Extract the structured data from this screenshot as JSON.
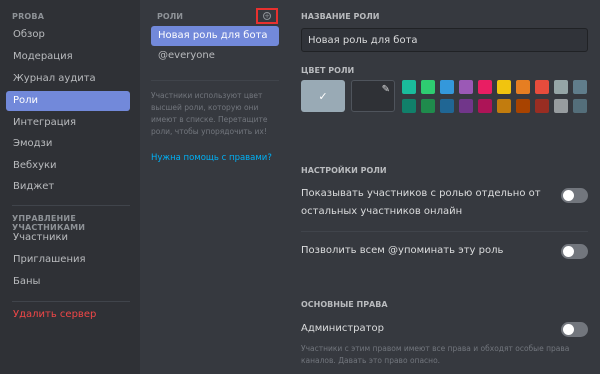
{
  "sidebar": {
    "server_section": "PROBA",
    "items": [
      {
        "label": "Обзор",
        "active": false
      },
      {
        "label": "Модерация",
        "active": false
      },
      {
        "label": "Журнал аудита",
        "active": false
      },
      {
        "label": "Роли",
        "active": true
      },
      {
        "label": "Интеграция",
        "active": false
      },
      {
        "label": "Эмодзи",
        "active": false
      },
      {
        "label": "Вебхуки",
        "active": false
      },
      {
        "label": "Виджет",
        "active": false
      }
    ],
    "members_section": "УПРАВЛЕНИЕ УЧАСТНИКАМИ",
    "member_items": [
      {
        "label": "Участники"
      },
      {
        "label": "Приглашения"
      },
      {
        "label": "Баны"
      }
    ],
    "delete_server": "Удалить сервер"
  },
  "roles": {
    "header": "РОЛИ",
    "items": [
      {
        "label": "Новая роль для бота",
        "selected": true
      },
      {
        "label": "@everyone",
        "selected": false
      }
    ],
    "hint": "Участники используют цвет высшей роли, которую они имеют в списке. Перетащите роли, чтобы упорядочить их!",
    "help_link": "Нужна помощь с правами?"
  },
  "role_settings": {
    "name_label": "НАЗВАНИЕ РОЛИ",
    "name_value": "Новая роль для бота",
    "color_label": "ЦВЕТ РОЛИ",
    "default_color": "#99aab5",
    "swatches_top": [
      "#1abc9c",
      "#2ecc71",
      "#3498db",
      "#9b59b6",
      "#e91e63",
      "#f1c40f",
      "#e67e22",
      "#e74c3c",
      "#95a5a6",
      "#607d8b"
    ],
    "swatches_bottom": [
      "#11806a",
      "#1f8b4c",
      "#206694",
      "#71368a",
      "#ad1457",
      "#c27c0e",
      "#a84300",
      "#992d22",
      "#979c9f",
      "#546e7a"
    ],
    "settings_label": "НАСТРОЙКИ РОЛИ",
    "toggle_hoist": {
      "label": "Показывать участников с ролью отдельно от остальных участников онлайн",
      "on": false
    },
    "toggle_mention": {
      "label": "Позволить всем @упоминать эту роль",
      "on": false
    },
    "permissions_label": "ОСНОВНЫЕ ПРАВА",
    "admin": {
      "label": "Администратор",
      "on": false,
      "description": "Участники с этим правом имеют все права и обходят особые права каналов. Давать это право опасно."
    }
  },
  "icons": {
    "add_role": "plus-circle-icon",
    "check": "check-icon",
    "eyedropper": "eyedropper-icon"
  }
}
